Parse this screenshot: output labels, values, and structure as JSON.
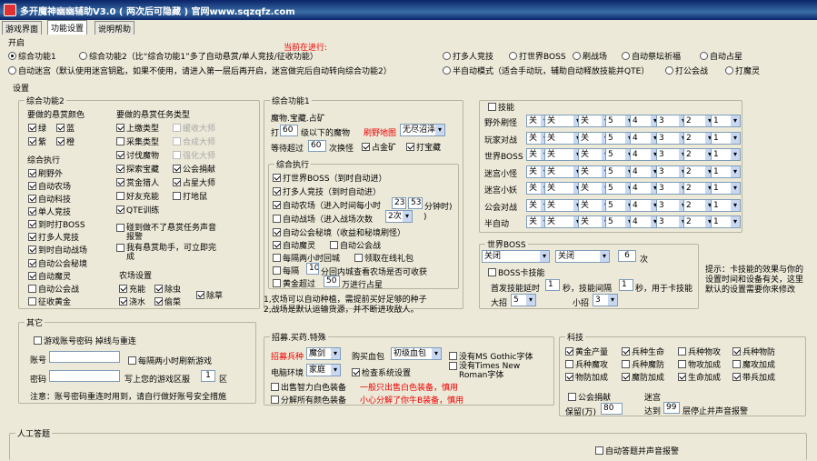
{
  "title": "多开魔神幽幽辅助V3.0 ( 两次后可隐藏 )      官网www.sqzqfz.com",
  "tabs": [
    "游戏界面",
    "功能设置",
    "说明帮助"
  ],
  "running_label": "当前在进行:",
  "start": {
    "label": "开启",
    "opts": [
      "综合功能1",
      "综合功能2（比“综合功能1”多了自动悬赏/单人竞技/征收功能）",
      "打多人竞技",
      "打世界BOSS",
      "刷战场",
      "自动祭坛祈福",
      "自动占星",
      "自动迷宫（默认使用迷宫钥匙，如果不使用，请进入第一层后再开启，迷宫做完后自动转向综合功能2）",
      "半自动模式（适合手动玩，辅助自动释放技能并QTE）",
      "打公会战",
      "打魔灵"
    ]
  },
  "settings_label": "设置",
  "f2": {
    "label": "综合功能2",
    "colors_title": "要做的悬赏颜色",
    "colors": [
      "绿",
      "蓝",
      "紫",
      "橙"
    ],
    "types_title": "要做的悬赏任务类型",
    "types": [
      "上缴类型",
      "缓收大师",
      "采集类型",
      "合成大师",
      "讨伐魔物",
      "强化大师",
      "探索宝藏",
      "公会捐献",
      "赏金猎人",
      "占星大师",
      "好友充能",
      "打地鼠",
      "QTE训练"
    ],
    "exec_title": "综合执行",
    "exec": [
      "刷野外",
      "自动农场",
      "自动科技",
      "单人竞技",
      "到时打BOSS",
      "打多人竞技",
      "到时自动战场",
      "自动公会秘境",
      "自动魔灵",
      "自动公会战",
      "征收黄金"
    ],
    "bounty": [
      "碰到做不了悬赏任务声音报警",
      "我有悬赏助手，可立即完成"
    ],
    "farm_title": "农场设置",
    "farm": [
      "充能",
      "除虫",
      "浇水",
      "偷菜",
      "除草"
    ]
  },
  "f1": {
    "label": "综合功能1",
    "sub": "魔物.宝藏.占矿",
    "hit": "打",
    "lvl": "60",
    "hit_suf": "级以下的魔物",
    "map_label": "刷野地图",
    "map": "无尽沼泽",
    "wait": "等待超过",
    "wait_v": "60",
    "wait_suf": "次换怪",
    "opt1": "占金矿",
    "opt2": "打宝藏",
    "exec_title": "综合执行",
    "exec": [
      "打世界BOSS（到时自动进）",
      "打多人竞技（到时自动进）",
      "自动农场（进入时间每小时",
      "自动战场（进入战场次数",
      "自动公会秘境（收益和秘境刷怪）",
      "自动魔灵",
      "自动公会战",
      "每隔两小时回城",
      "领取在线礼包",
      "每隔",
      "分回内城查看农场是否可收获",
      "黄金超过",
      "万进行占星"
    ],
    "farm_min1": "23",
    "farm_min2": "53",
    "farm_min_suf": "分钟时)",
    "bt_v": "2次",
    "bt_suf": ")",
    "every_v": "10",
    "gold_v": "50",
    "note": "1,农场可以自动种植，需提前买好足够的种子\n2,战场是默认运输货源，并不断进攻敌人。"
  },
  "skill": {
    "label": "技能",
    "rows": [
      "野外刷怪",
      "玩家对战",
      "世界BOSS",
      "迷宫小怪",
      "迷宫小妖",
      "公会对战",
      "半自动"
    ],
    "cols": [
      "关",
      "关",
      "关",
      "5",
      "4",
      "3",
      "2",
      "1"
    ]
  },
  "wb": {
    "label": "世界BOSS",
    "s1": "关闭",
    "s2": "关闭",
    "v": "6",
    "suf": "次",
    "skill": "BOSS卡技能",
    "first": "首发技能延时",
    "first_v": "1",
    "sec": "秒，技能间隔",
    "gap_v": "1",
    "gap_suf": "秒，用于卡技能",
    "big": "大招",
    "big_v": "5",
    "small": "小招",
    "small_v": "3",
    "tip": "提示：卡技能的效果与你的设置时间和设备有关，这里默认的设置需要你来修改"
  },
  "other": {
    "label": "其它",
    "relog": "游戏账号密码 掉线与重连",
    "acc": "账号",
    "acc_v": "",
    "relog2": "每隔两小时刷新游戏",
    "pwd": "密码",
    "pwd_v": "",
    "area": "写上您的游戏区服",
    "area_v": "1",
    "area_suf": "区",
    "warn": "注意：账号密码重连时用到，请自行做好账号安全措施"
  },
  "recruit": {
    "label": "招募.买药.特殊",
    "r1": "招募兵种",
    "r1_v": "魔剑",
    "buy": "购买血包",
    "buy_v": "初级血包",
    "font": "没有MS Gothic字体",
    "env": "电脑环境",
    "env_v": "家庭",
    "check": "检查系统设置",
    "tnr": "没有Times New Roman字体",
    "sell": "出售智力白色装备",
    "sell_note": "一般只出售白色装备，慎用",
    "dec": "分解所有颜色装备",
    "dec_note": "小心分解了你牛B装备，慎用"
  },
  "tech": {
    "label": "科技",
    "items": [
      "黄金产量",
      "兵种生命",
      "兵种物攻",
      "兵种物防",
      "兵种魔攻",
      "兵种魔防",
      "物攻加成",
      "魔攻加成",
      "物防加成",
      "魔防加成",
      "生命加成",
      "带兵加成"
    ],
    "donate": "公会捐献",
    "keep": "保留(万)",
    "keep_v": "80",
    "maze": "迷宫",
    "reach": "达到",
    "reach_v": "99",
    "reach_suf": "层停止并声音报警"
  },
  "answer": {
    "label": "人工答题",
    "auto": "自动答题并声音报警"
  }
}
